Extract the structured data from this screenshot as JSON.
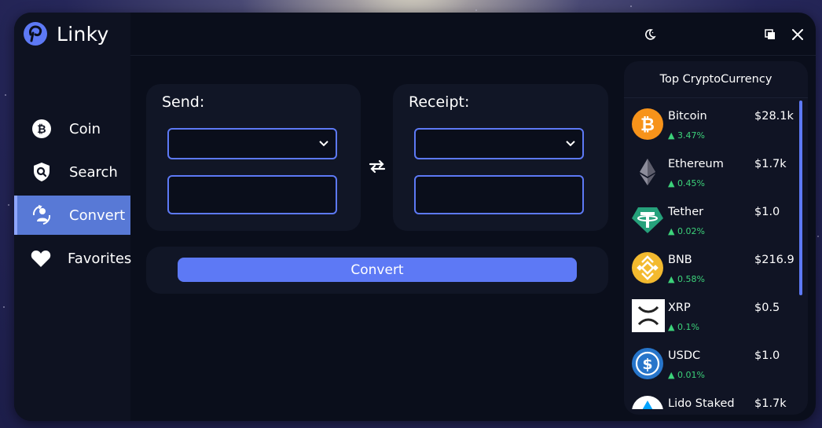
{
  "app": {
    "name": "Linky"
  },
  "sidebar": {
    "items": [
      {
        "label": "Coin",
        "icon": "bitcoin-icon",
        "active": false
      },
      {
        "label": "Search",
        "icon": "search-shield-icon",
        "active": false
      },
      {
        "label": "Convert",
        "icon": "convert-user-icon",
        "active": true
      },
      {
        "label": "Favorites",
        "icon": "heart-icon",
        "active": false
      }
    ]
  },
  "topbar": {
    "icons": [
      "moon-icon",
      "copy-icon",
      "close-icon"
    ]
  },
  "send": {
    "title": "Send:",
    "select_value": "",
    "amount_value": ""
  },
  "receipt": {
    "title": "Receipt:",
    "select_value": "",
    "amount_value": ""
  },
  "convert": {
    "label": "Convert"
  },
  "crypto": {
    "title": "Top CryptoCurrency",
    "coins": [
      {
        "name": "Bitcoin",
        "price": "$28.1k",
        "change": "3.47%",
        "icon": "bitcoin-icon"
      },
      {
        "name": "Ethereum",
        "price": "$1.7k",
        "change": "0.45%",
        "icon": "ethereum-icon"
      },
      {
        "name": "Tether",
        "price": "$1.0",
        "change": "0.02%",
        "icon": "tether-icon"
      },
      {
        "name": "BNB",
        "price": "$216.9",
        "change": "0.58%",
        "icon": "bnb-icon"
      },
      {
        "name": "XRP",
        "price": "$0.5",
        "change": "0.1%",
        "icon": "xrp-icon"
      },
      {
        "name": "USDC",
        "price": "$1.0",
        "change": "0.01%",
        "icon": "usdc-icon"
      },
      {
        "name": "Lido Staked",
        "price": "$1.7k",
        "change": "",
        "icon": "lido-staked-icon"
      }
    ]
  },
  "colors": {
    "accent": "#5d79f5",
    "positive": "#3cd27a",
    "window": "#0a0e1b",
    "panel": "#111626"
  }
}
